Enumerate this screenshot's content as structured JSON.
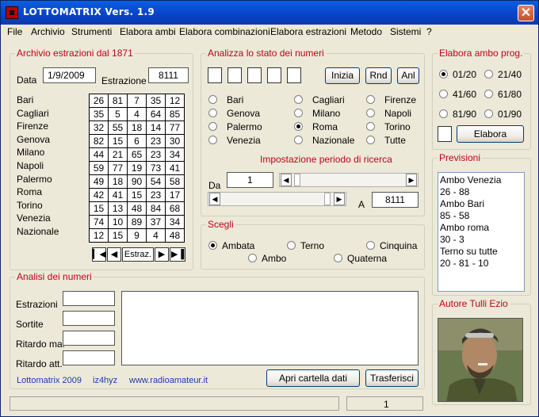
{
  "window": {
    "title": "LOTTOMATRIX  Vers. 1.9",
    "close": "✕"
  },
  "menu": [
    "File",
    "Archivio",
    "Strumenti",
    "Elabora ambi",
    "Elabora combinazioni",
    "Elabora estrazioni",
    "Metodo",
    "Sistemi",
    "?"
  ],
  "archivio": {
    "title": "Archivio estrazioni dal 1871",
    "data_label": "Data",
    "data_value": "1/9/2009",
    "estrazione_label": "Estrazione",
    "estrazione_value": "8111",
    "nav_label": "Estraz.",
    "rows": [
      {
        "ruota": "Bari",
        "numbers": [
          "26",
          "81",
          "7",
          "35",
          "12"
        ]
      },
      {
        "ruota": "Cagliari",
        "numbers": [
          "35",
          "5",
          "4",
          "64",
          "85"
        ]
      },
      {
        "ruota": "Firenze",
        "numbers": [
          "32",
          "55",
          "18",
          "14",
          "77"
        ]
      },
      {
        "ruota": "Genova",
        "numbers": [
          "82",
          "15",
          "6",
          "23",
          "30"
        ]
      },
      {
        "ruota": "Milano",
        "numbers": [
          "44",
          "21",
          "65",
          "23",
          "34"
        ]
      },
      {
        "ruota": "Napoli",
        "numbers": [
          "59",
          "77",
          "19",
          "73",
          "41"
        ]
      },
      {
        "ruota": "Palermo",
        "numbers": [
          "49",
          "18",
          "90",
          "54",
          "58"
        ]
      },
      {
        "ruota": "Roma",
        "numbers": [
          "42",
          "41",
          "15",
          "23",
          "17"
        ]
      },
      {
        "ruota": "Torino",
        "numbers": [
          "15",
          "13",
          "48",
          "84",
          "68"
        ]
      },
      {
        "ruota": "Venezia",
        "numbers": [
          "74",
          "10",
          "89",
          "37",
          "34"
        ]
      },
      {
        "ruota": "Nazionale",
        "numbers": [
          "12",
          "15",
          "9",
          "4",
          "48"
        ]
      }
    ]
  },
  "analizza": {
    "title": "Analizza lo stato dei numeri",
    "buttons": {
      "inizia": "Inizia",
      "rnd": "Rnd",
      "anl": "Anl"
    },
    "ruote": [
      {
        "label": "Bari",
        "selected": false
      },
      {
        "label": "Cagliari",
        "selected": false
      },
      {
        "label": "Firenze",
        "selected": false
      },
      {
        "label": "Genova",
        "selected": false
      },
      {
        "label": "Milano",
        "selected": false
      },
      {
        "label": "Napoli",
        "selected": false
      },
      {
        "label": "Palermo",
        "selected": false
      },
      {
        "label": "Roma",
        "selected": true
      },
      {
        "label": "Torino",
        "selected": false
      },
      {
        "label": "Venezia",
        "selected": false
      },
      {
        "label": "Nazionale",
        "selected": false
      },
      {
        "label": "Tutte",
        "selected": false
      }
    ],
    "periodo_title": "Impostazione periodo di ricerca",
    "da_label": "Da",
    "da_value": "1",
    "a_label": "A",
    "a_value": "8111"
  },
  "scegli": {
    "title": "Scegli",
    "options": [
      {
        "label": "Ambata",
        "selected": true
      },
      {
        "label": "Terno",
        "selected": false
      },
      {
        "label": "Cinquina",
        "selected": false
      },
      {
        "label": "Ambo",
        "selected": false
      },
      {
        "label": "Quaterna",
        "selected": false
      }
    ]
  },
  "ambo_prog": {
    "title": "Elabora ambo prog.",
    "options": [
      {
        "label": "01/20",
        "selected": true
      },
      {
        "label": "21/40",
        "selected": false
      },
      {
        "label": "41/60",
        "selected": false
      },
      {
        "label": "61/80",
        "selected": false
      },
      {
        "label": "81/90",
        "selected": false
      },
      {
        "label": "01/90",
        "selected": false
      }
    ],
    "elabora": "Elabora"
  },
  "previsioni": {
    "title": "Previsioni",
    "lines": [
      "Ambo Venezia",
      "26 - 88",
      "Ambo Bari",
      "85 - 58",
      "Ambo roma",
      "30 - 3",
      "Terno su tutte",
      "20 - 81 - 10"
    ]
  },
  "analisi": {
    "title": "Analisi dei numeri",
    "labels": [
      "Estrazioni",
      "Sortite",
      "Ritardo ma.",
      "Ritardo att."
    ],
    "footer": [
      "Lottomatrix 2009",
      "iz4hyz",
      "www.radioamateur.it"
    ],
    "apri": "Apri cartella dati",
    "trasferisci": "Trasferisci"
  },
  "autore": {
    "title": "Autore Tulli Ezio"
  },
  "status": {
    "value": "1"
  }
}
